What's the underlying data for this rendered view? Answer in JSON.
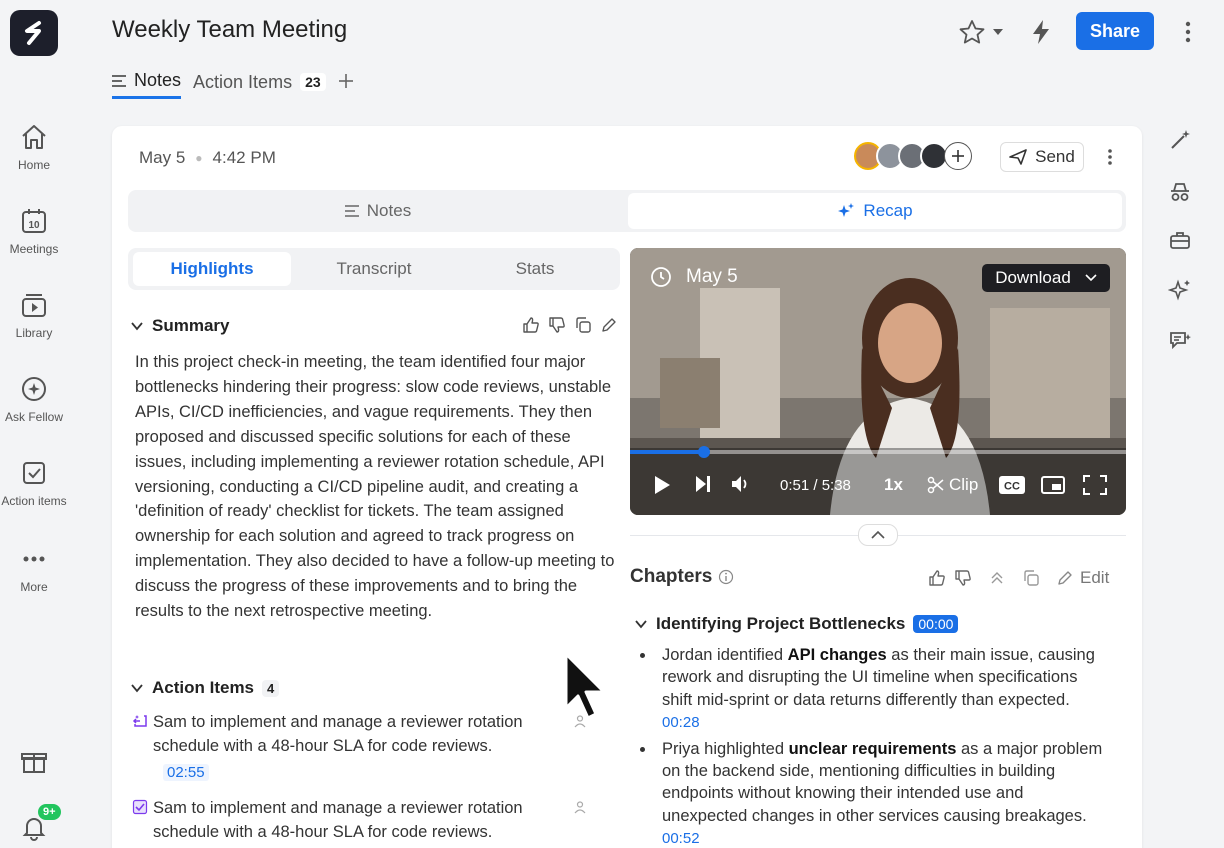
{
  "header": {
    "title": "Weekly Team Meeting",
    "tabs": [
      {
        "label": "Notes"
      },
      {
        "label": "Action Items",
        "count": "23"
      }
    ],
    "share_label": "Share"
  },
  "nav": {
    "items": [
      {
        "label": "Home"
      },
      {
        "label": "Meetings"
      },
      {
        "label": "Library"
      },
      {
        "label": "Ask Fellow"
      },
      {
        "label": "Action items"
      },
      {
        "label": "More"
      }
    ],
    "notification_badge": "9+"
  },
  "meeting": {
    "date": "May 5",
    "time": "4:42 PM",
    "send_label": "Send"
  },
  "segment": {
    "notes_label": "Notes",
    "recap_label": "Recap"
  },
  "subtabs": {
    "highlights": "Highlights",
    "transcript": "Transcript",
    "stats": "Stats"
  },
  "summary": {
    "title": "Summary",
    "text": "In this project check-in meeting, the team identified four major bottlenecks hindering their progress: slow code reviews, unstable APIs, CI/CD inefficiencies, and vague requirements. They then proposed and discussed specific solutions for each of these issues, including implementing a reviewer rotation schedule, API versioning, conducting a CI/CD pipeline audit, and creating a 'definition of ready' checklist for tickets. The team assigned ownership for each solution and agreed to track progress on implementation. They also decided to have a follow-up meeting to discuss the progress of these improvements and to bring the results to the next retrospective meeting."
  },
  "action_items": {
    "title": "Action Items",
    "count": "4",
    "items": [
      {
        "text": "Sam to implement and manage a reviewer rotation schedule with a 48-hour SLA for code reviews.",
        "timestamp": "02:55",
        "checked": false
      },
      {
        "text": "Sam to implement and manage a reviewer rotation schedule with a 48-hour SLA for code reviews.",
        "timestamp": "",
        "checked": true
      }
    ]
  },
  "video": {
    "date": "May 5",
    "download_label": "Download",
    "time": "0:51 / 5:38",
    "progress_fraction": 0.15,
    "speed": "1x",
    "clip_label": "Clip",
    "cc_label": "CC"
  },
  "chapters": {
    "title": "Chapters",
    "edit_label": "Edit",
    "chapter": {
      "title": "Identifying Project Bottlenecks",
      "timestamp": "00:00",
      "bullets": [
        {
          "pre": "Jordan identified ",
          "bold": "API changes",
          "post": " as their main issue, causing rework and disrupting the UI timeline when specifications shift mid-sprint or data returns differently than expected.",
          "timestamp": "00:28"
        },
        {
          "pre": "Priya highlighted ",
          "bold": "unclear requirements",
          "post": " as a major problem on the backend side, mentioning difficulties in building endpoints without knowing their intended use and unexpected changes in other services causing breakages.",
          "timestamp": "00:52"
        }
      ]
    }
  },
  "colors": {
    "accent": "#1a6fe6",
    "notification": "#22c55e"
  }
}
